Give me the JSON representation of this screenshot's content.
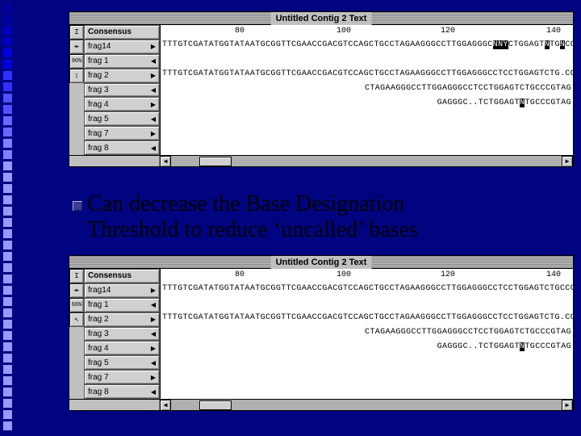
{
  "window": {
    "title": "Untitled Contig 2 Text"
  },
  "ruler": {
    "t80": "80",
    "t100": "100",
    "t120": "120",
    "t140": "140"
  },
  "tools": {
    "ibeam": "I",
    "split": "⇹",
    "percent_top": "90%",
    "percent_bottom": "66%",
    "updown": "↕",
    "cursor": "↖"
  },
  "rows_top": {
    "consensus": {
      "label": "Consensus",
      "seq": "TTTGTCGATATGGTATAATGCGGTTCGAACCGACGTCCAGCTGCCTAGAAGGGCCTTGGAGGGC",
      "hl1": "NNY",
      "mid": "CTGGAGT",
      "hl2": "N",
      "mid2": "TG",
      "hl3": "N",
      "tail": "CCGTAG"
    },
    "frag14": {
      "label": "frag14",
      "arrow": "▶",
      "seq": ""
    },
    "frag1": {
      "label": "frag 1",
      "arrow": "◀",
      "seq": "TTTGTCGATATGGTATAATGCGGTTCGAACCGACGTCCAGCTGCCTAGAAGGGCCTTGGAGGGCCTCCTGGAGTCTG.CCGTAG"
    },
    "frag2": {
      "label": "frag 2",
      "arrow": "▶",
      "seq": "CTAGAAGGGCCTTGGAGGGCCTCCTGGAGTCTGCCCGTAG"
    },
    "frag3": {
      "label": "frag 3",
      "arrow": "◀",
      "pre": "GAGGGC..TCTGGAGT",
      "hl": "N",
      "post": "TGCCCGTAG"
    },
    "frag4": {
      "label": "frag 4",
      "arrow": "▶"
    },
    "frag5": {
      "label": "frag 5",
      "arrow": "◀"
    },
    "frag7": {
      "label": "frag 7",
      "arrow": "▶"
    },
    "frag8": {
      "label": "frag 8",
      "arrow": "◀"
    }
  },
  "rows_bottom": {
    "consensus": {
      "label": "Consensus",
      "seq": "TTTGTCGATATGGTATAATGCGGTTCGAACCGACGTCCAGCTGCCTAGAAGGGCCTTGGAGGGCCTCCTGGAGTCTGCCCGTAG"
    },
    "frag14": {
      "label": "frag14",
      "arrow": "▶",
      "seq": ""
    },
    "frag1": {
      "label": "frag 1",
      "arrow": "◀",
      "seq": "TTTGTCGATATGGTATAATGCGGTTCGAACCGACGTCCAGCTGCCTAGAAGGGCCTTGGAGGGCCTCCTGGAGTCTG.CCGTAG"
    },
    "frag2": {
      "label": "frag 2",
      "arrow": "▶",
      "seq": "CTAGAAGGGCCTTGGAGGGCCTCCTGGAGTCTGCCCGTAG"
    },
    "frag3": {
      "label": "frag 3",
      "arrow": "◀",
      "pre": "GAGGGC..TCTGGAGT",
      "hl": "N",
      "post": "TGCCCGTAG"
    },
    "frag4": {
      "label": "frag 4",
      "arrow": "▶"
    },
    "frag5": {
      "label": "frag 5",
      "arrow": "◀"
    },
    "frag7": {
      "label": "frag 7",
      "arrow": "▶"
    },
    "frag8": {
      "label": "frag 8",
      "arrow": "◀"
    }
  },
  "caption": {
    "line1": "Can decrease the Base Designation",
    "line2": "Threshold to reduce ‘uncalled’ bases"
  }
}
